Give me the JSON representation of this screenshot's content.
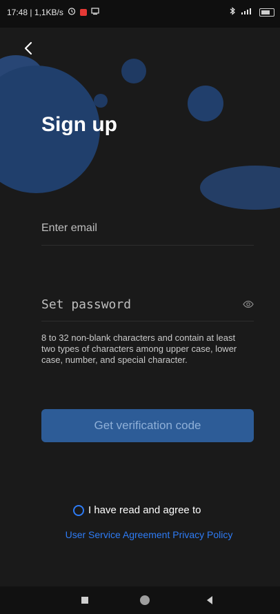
{
  "status_bar": {
    "time_speed": "17:48 | 1,1KB/s",
    "icons": [
      "alarm-icon",
      "notification-icon",
      "cast-icon",
      "bluetooth-icon",
      "signal-icon",
      "battery-icon"
    ]
  },
  "header": {
    "title": "Sign up"
  },
  "form": {
    "email_placeholder": "Enter email",
    "password_placeholder": "Set password",
    "password_hint": "8 to 32 non-blank characters and contain at least two types of characters among upper case, lower case, number, and special character.",
    "get_code_label": "Get verification code"
  },
  "agreement": {
    "text": "I have read and agree to",
    "user_agreement": "User Service Agreement",
    "privacy_policy": "Privacy Policy"
  },
  "colors": {
    "accent": "#2e7cf6",
    "button_bg": "#2d5c97",
    "background": "#1a1a1a"
  }
}
